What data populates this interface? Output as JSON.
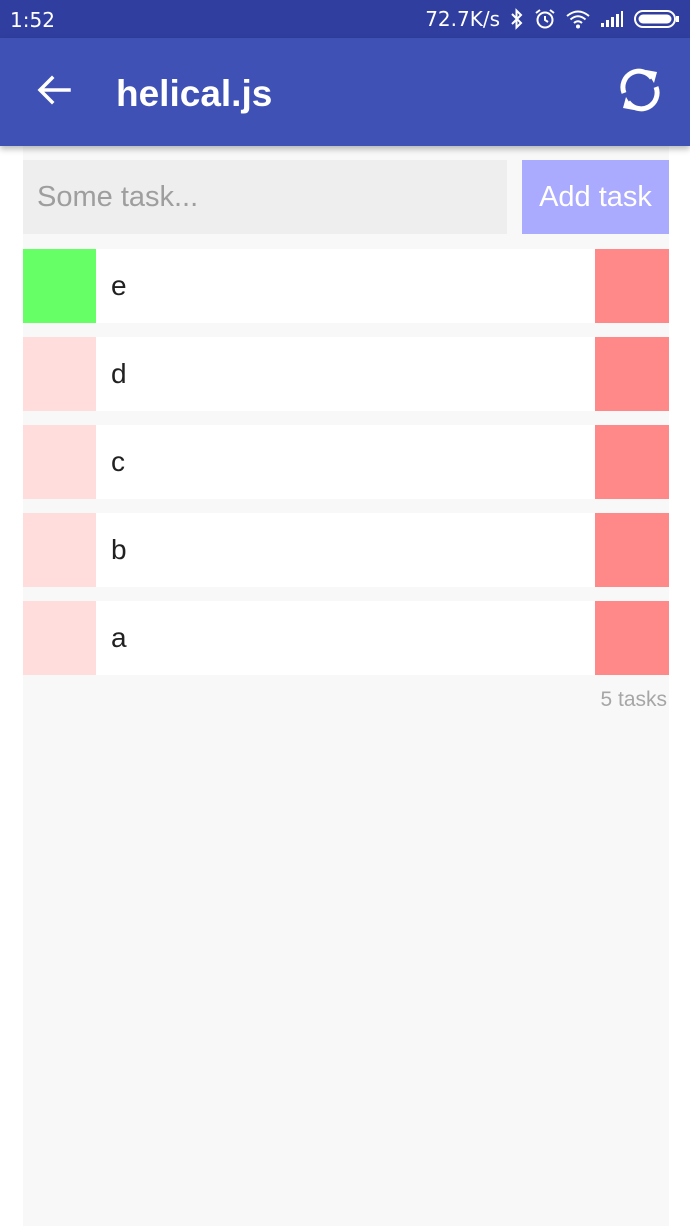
{
  "status_bar": {
    "time": "1:52",
    "network_speed": "72.7K/s",
    "icons": [
      "bluetooth-icon",
      "alarm-icon",
      "wifi-icon",
      "signal-icon",
      "battery-icon"
    ]
  },
  "app_bar": {
    "title": "helical.js",
    "back_icon": "arrow-left-icon",
    "refresh_icon": "refresh-icon",
    "background": "#3f51b5"
  },
  "add_form": {
    "placeholder": "Some task...",
    "value": "",
    "button_label": "Add task",
    "button_color": "#aaaaff"
  },
  "tasks": [
    {
      "label": "e",
      "done": true
    },
    {
      "label": "d",
      "done": false
    },
    {
      "label": "c",
      "done": false
    },
    {
      "label": "b",
      "done": false
    },
    {
      "label": "a",
      "done": false
    }
  ],
  "task_count_label": "5 tasks",
  "colors": {
    "done_toggle": "#66ff66",
    "pending_toggle": "#ffdddd",
    "delete": "#ff8888",
    "status_bar": "#303f9f"
  }
}
